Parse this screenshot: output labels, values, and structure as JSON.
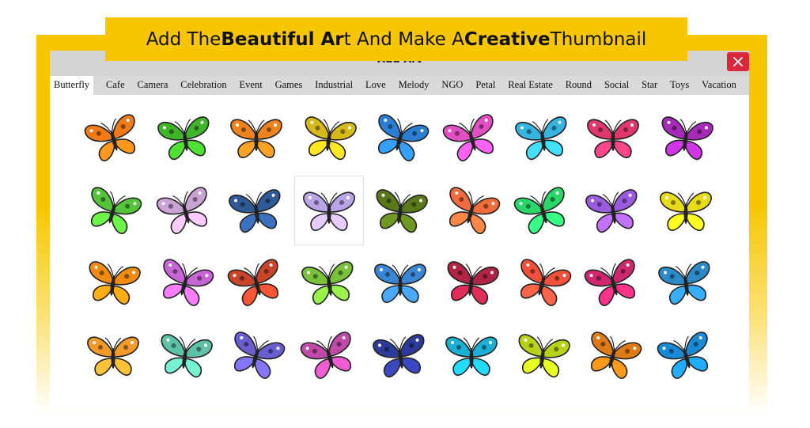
{
  "banner": {
    "part1": "Add The ",
    "bold1": "Beautiful Ar",
    "part2": "t And Make A ",
    "bold2": "Creative",
    "part3": " Thumbnail"
  },
  "dialog": {
    "title": "Add Art",
    "close_icon": "close-icon"
  },
  "tabs": [
    {
      "label": "Butterfly",
      "active": true
    },
    {
      "label": "Cafe"
    },
    {
      "label": "Camera"
    },
    {
      "label": "Celebration"
    },
    {
      "label": "Event"
    },
    {
      "label": "Games"
    },
    {
      "label": "Industrial"
    },
    {
      "label": "Love"
    },
    {
      "label": "Melody"
    },
    {
      "label": "NGO"
    },
    {
      "label": "Petal"
    },
    {
      "label": "Real Estate"
    },
    {
      "label": "Round"
    },
    {
      "label": "Social"
    },
    {
      "label": "Star"
    },
    {
      "label": "Toys"
    },
    {
      "label": "Vacation"
    }
  ],
  "butterflies": [
    [
      "#f07a18",
      "#3fb52a",
      "#f0821e",
      "#d8b91a",
      "#2a7fd4",
      "#e24fc3",
      "#35b4e0",
      "#e0386e",
      "#a62ab8"
    ],
    [
      "#56c43a",
      "#c9a2d6",
      "#2f5a98",
      "#b9a4e8",
      "#5a7a1a",
      "#f26b3a",
      "#2ad86a",
      "#9a5be0",
      "#e8dc18"
    ],
    [
      "#f08a10",
      "#c765d6",
      "#c8452a",
      "#7ac23a",
      "#3a86d6",
      "#b22446",
      "#f2503a",
      "#d0286e",
      "#2d8ac8"
    ],
    [
      "#f29a2a",
      "#5ec2a8",
      "#6a5ed0",
      "#c04aa8",
      "#2e3a9a",
      "#1ab0d6",
      "#b8d21a",
      "#e07a18",
      "#1a8ad6"
    ]
  ],
  "selected_cell": "1-3"
}
